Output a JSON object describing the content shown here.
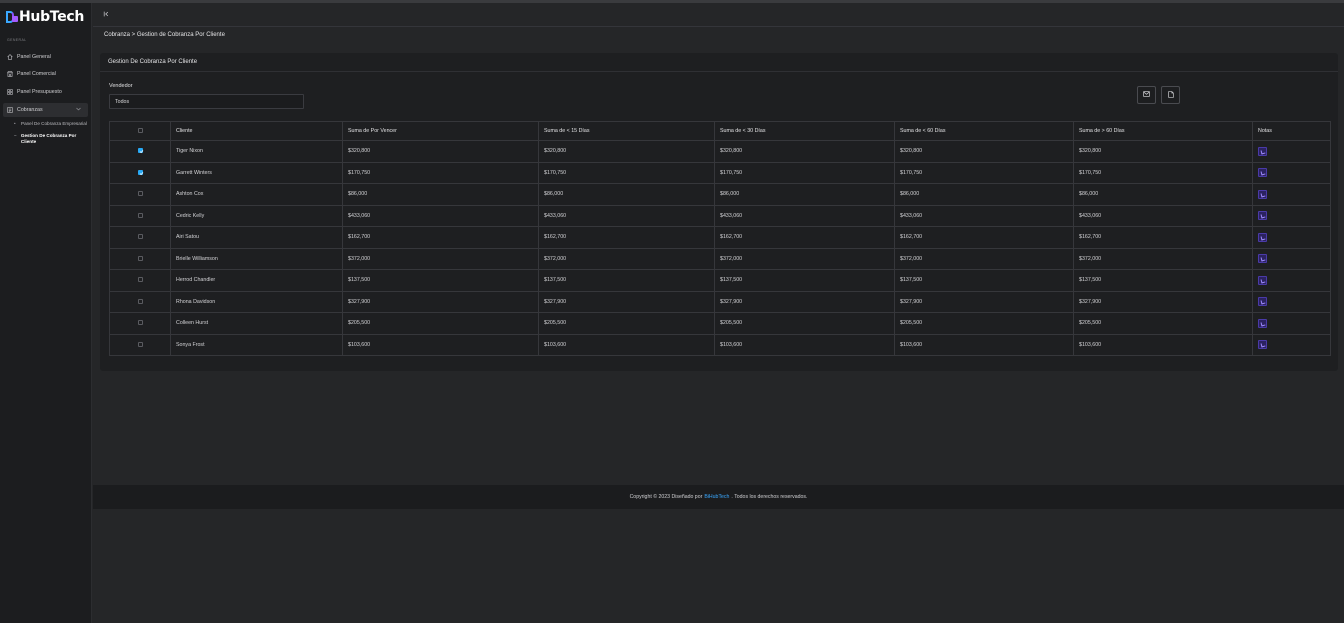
{
  "brand": {
    "name": "HubTech"
  },
  "sidebar": {
    "section_label": "GENERAL",
    "items": [
      {
        "label": "Panel General",
        "icon": "home-icon"
      },
      {
        "label": "Panel Comercial",
        "icon": "store-icon"
      },
      {
        "label": "Panel Presupuesto",
        "icon": "grid-icon"
      },
      {
        "label": "Cobranzas",
        "icon": "ledger-icon",
        "expanded": true
      }
    ],
    "sub_items": [
      {
        "label": "Panel De Cobranza Empresarial",
        "active": false
      },
      {
        "label": "Gestion De Cobranza Por Cliente",
        "active": true
      }
    ]
  },
  "header": {
    "collapse_icon": "collapse-left-icon"
  },
  "breadcrumb": "Cobranza > Gestion de Cobranza Por Cliente",
  "card": {
    "title": "Gestion De Cobranza Por Cliente",
    "vendedor_label": "Vendedor",
    "vendedor_value": "Todos"
  },
  "table": {
    "columns": [
      "Cliente",
      "Suma de Por Vencer",
      "Suma de < 15 Días",
      "Suma de < 30 Días",
      "Suma de < 60 Días",
      "Suma de > 60 Días",
      "Notas"
    ],
    "rows": [
      {
        "checked": true,
        "cliente": "Tiger Nixon",
        "v": [
          "$320,800",
          "$320,800",
          "$320,800",
          "$320,800",
          "$320,800"
        ]
      },
      {
        "checked": true,
        "cliente": "Garrett Winters",
        "v": [
          "$170,750",
          "$170,750",
          "$170,750",
          "$170,750",
          "$170,750"
        ]
      },
      {
        "checked": false,
        "cliente": "Ashton Cox",
        "v": [
          "$86,000",
          "$86,000",
          "$86,000",
          "$86,000",
          "$86,000"
        ]
      },
      {
        "checked": false,
        "cliente": "Cedric Kelly",
        "v": [
          "$433,060",
          "$433,060",
          "$433,060",
          "$433,060",
          "$433,060"
        ]
      },
      {
        "checked": false,
        "cliente": "Airi Satou",
        "v": [
          "$162,700",
          "$162,700",
          "$162,700",
          "$162,700",
          "$162,700"
        ]
      },
      {
        "checked": false,
        "cliente": "Brielle Williamson",
        "v": [
          "$372,000",
          "$372,000",
          "$372,000",
          "$372,000",
          "$372,000"
        ]
      },
      {
        "checked": false,
        "cliente": "Herrod Chandler",
        "v": [
          "$137,500",
          "$137,500",
          "$137,500",
          "$137,500",
          "$137,500"
        ]
      },
      {
        "checked": false,
        "cliente": "Rhona Davidson",
        "v": [
          "$327,900",
          "$327,900",
          "$327,900",
          "$327,900",
          "$327,900"
        ]
      },
      {
        "checked": false,
        "cliente": "Colleen Hurst",
        "v": [
          "$205,500",
          "$205,500",
          "$205,500",
          "$205,500",
          "$205,500"
        ]
      },
      {
        "checked": false,
        "cliente": "Sonya Frost",
        "v": [
          "$103,600",
          "$103,600",
          "$103,600",
          "$103,600",
          "$103,600"
        ]
      }
    ]
  },
  "footer": {
    "prefix": "Copyright © 2023 Diseñado por",
    "brand": "BiHubTech",
    "suffix": ". Todos los derechos reservados."
  },
  "colors": {
    "accent": "#27a9f5",
    "note_button": "#2b2260",
    "background": "#252628",
    "panel": "#1e1f21"
  }
}
